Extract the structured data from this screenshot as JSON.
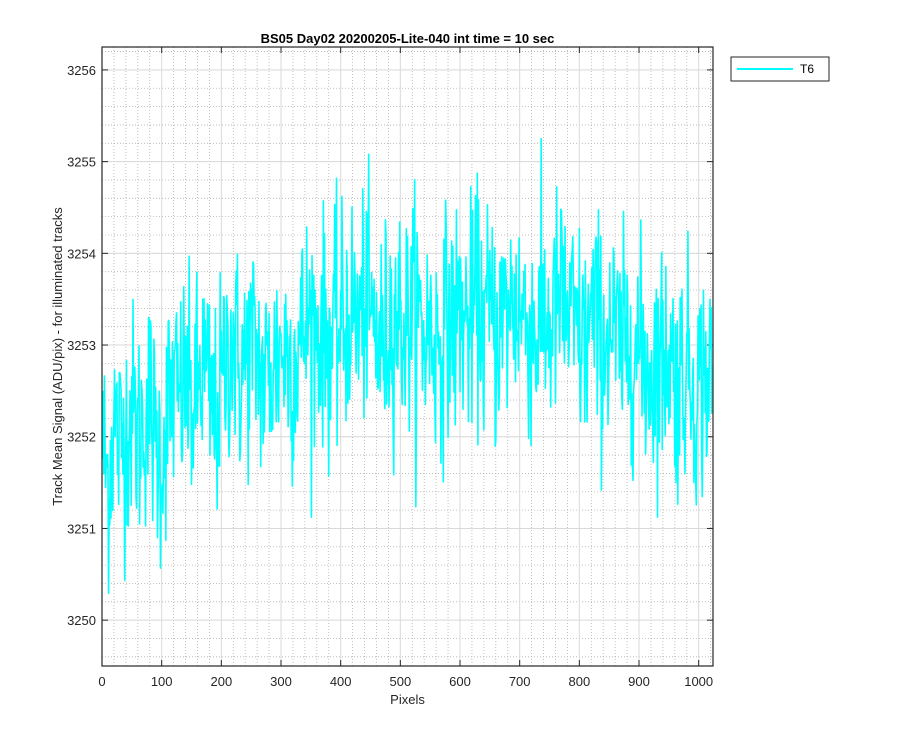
{
  "chart_data": {
    "type": "line",
    "title": "BS05 Day02 20200205-Lite-040 int time = 10 sec",
    "xlabel": "Pixels",
    "ylabel": "Track Mean Signal (ADU/pix) - for illuminated tracks",
    "xlim": [
      0,
      1024
    ],
    "ylim": [
      3249.5,
      3256.25
    ],
    "xticks": [
      0,
      100,
      200,
      300,
      400,
      500,
      600,
      700,
      800,
      900,
      1000
    ],
    "yticks": [
      3250,
      3251,
      3252,
      3253,
      3254,
      3255,
      3256
    ],
    "grid": true,
    "minor_grid": true,
    "legend_position": "outside-top-right",
    "series": [
      {
        "name": "T6",
        "color": "#00ffff",
        "x": [
          0,
          10,
          20,
          30,
          40,
          50,
          60,
          70,
          80,
          90,
          100,
          110,
          120,
          130,
          140,
          150,
          160,
          170,
          180,
          190,
          200,
          210,
          220,
          230,
          240,
          250,
          260,
          270,
          280,
          290,
          300,
          310,
          320,
          330,
          340,
          350,
          360,
          370,
          380,
          390,
          400,
          410,
          420,
          430,
          440,
          450,
          460,
          470,
          480,
          490,
          500,
          510,
          520,
          530,
          540,
          550,
          560,
          570,
          580,
          590,
          600,
          610,
          620,
          630,
          640,
          650,
          660,
          670,
          680,
          690,
          700,
          710,
          720,
          730,
          740,
          750,
          760,
          770,
          780,
          790,
          800,
          810,
          820,
          830,
          840,
          850,
          860,
          870,
          880,
          890,
          900,
          910,
          920,
          930,
          940,
          950,
          960,
          970,
          980,
          990,
          1000,
          1010,
          1020
        ],
        "values": [
          3252.0,
          3251.5,
          3252.2,
          3251.9,
          3252.1,
          3252.3,
          3252.0,
          3252.2,
          3252.4,
          3251.9,
          3251.8,
          3252.3,
          3252.5,
          3252.4,
          3252.6,
          3252.3,
          3252.5,
          3252.8,
          3252.4,
          3252.2,
          3252.5,
          3252.9,
          3253.1,
          3252.7,
          3252.8,
          3253.0,
          3252.9,
          3252.6,
          3252.7,
          3252.8,
          3253.0,
          3252.9,
          3252.8,
          3253.0,
          3253.2,
          3253.3,
          3253.1,
          3253.2,
          3253.0,
          3253.1,
          3253.2,
          3253.3,
          3253.4,
          3253.2,
          3253.5,
          3253.3,
          3253.1,
          3253.0,
          3253.2,
          3253.4,
          3253.3,
          3253.2,
          3253.4,
          3253.3,
          3253.1,
          3253.2,
          3253.0,
          3253.1,
          3253.3,
          3253.2,
          3253.4,
          3253.2,
          3253.3,
          3253.5,
          3253.2,
          3253.4,
          3253.1,
          3253.3,
          3253.3,
          3253.5,
          3253.4,
          3253.3,
          3253.2,
          3253.1,
          3253.3,
          3253.2,
          3253.4,
          3253.5,
          3253.3,
          3253.2,
          3253.1,
          3253.0,
          3253.3,
          3253.2,
          3253.0,
          3253.2,
          3253.1,
          3252.9,
          3253.0,
          3253.1,
          3252.9,
          3252.8,
          3252.7,
          3252.9,
          3252.8,
          3253.0,
          3252.6,
          3252.7,
          3252.8,
          3252.6,
          3252.5,
          3252.7,
          3252.6
        ]
      }
    ]
  }
}
